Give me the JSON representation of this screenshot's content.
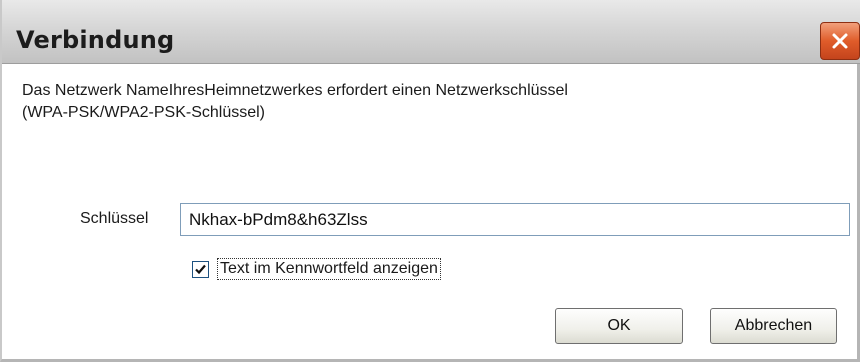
{
  "window": {
    "title": "Verbindung"
  },
  "message": {
    "line1": "Das Netzwerk NameIhresHeimnetzwerkes erfordert einen Netzwerkschlüssel",
    "line2": "(WPA-PSK/WPA2-PSK-Schlüssel)"
  },
  "key_field": {
    "label": "Schlüssel",
    "value": "Nkhax-bPdm8&h63Zlss"
  },
  "show_text_checkbox": {
    "label": "Text im Kennwortfeld anzeigen",
    "checked": true
  },
  "buttons": {
    "ok": "OK",
    "cancel": "Abbrechen"
  },
  "colors": {
    "close_button": "#e05c2a",
    "titlebar": "#d6d6d6",
    "input_border": "#7f9db9"
  },
  "icons": {
    "close": "close-icon",
    "check": "checkmark-icon"
  }
}
